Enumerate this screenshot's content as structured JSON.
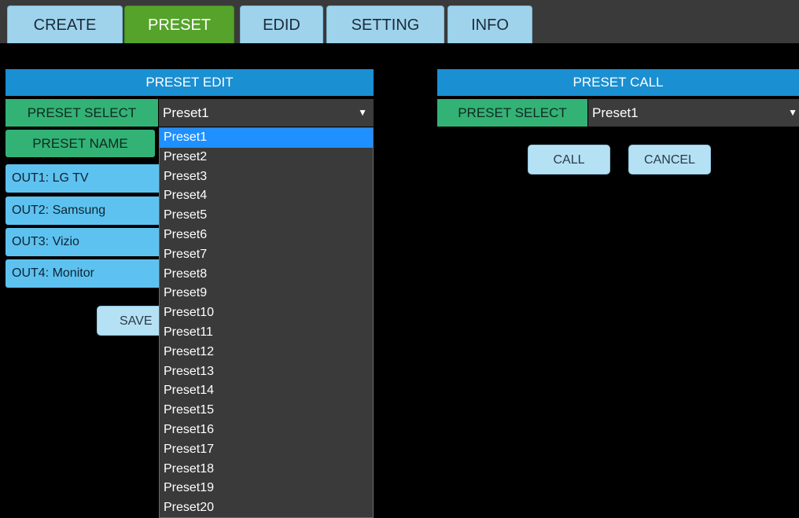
{
  "tabs": [
    {
      "label": "CREATE",
      "active": false
    },
    {
      "label": "PRESET",
      "active": true
    },
    {
      "label": "EDID",
      "active": false
    },
    {
      "label": "SETTING",
      "active": false
    },
    {
      "label": "INFO",
      "active": false
    }
  ],
  "preset_edit": {
    "title": "PRESET EDIT",
    "select_label": "PRESET SELECT",
    "selected_value": "Preset1",
    "name_label": "PRESET NAME",
    "outputs": [
      "OUT1: LG TV",
      "OUT2: Samsung",
      "OUT3: Vizio",
      "OUT4: Monitor"
    ],
    "save_label": "SAVE",
    "dropdown_options": [
      "Preset1",
      "Preset2",
      "Preset3",
      "Preset4",
      "Preset5",
      "Preset6",
      "Preset7",
      "Preset8",
      "Preset9",
      "Preset10",
      "Preset11",
      "Preset12",
      "Preset13",
      "Preset14",
      "Preset15",
      "Preset16",
      "Preset17",
      "Preset18",
      "Preset19",
      "Preset20"
    ]
  },
  "preset_call": {
    "title": "PRESET CALL",
    "select_label": "PRESET SELECT",
    "selected_value": "Preset1",
    "call_label": "CALL",
    "cancel_label": "CANCEL"
  },
  "icons": {
    "dropdown_caret": "▼"
  },
  "colors": {
    "header_blue": "#1a8fd2",
    "label_green": "#33b276",
    "active_tab_green": "#55a32a",
    "tab_light_blue": "#9fd3ec",
    "output_blue": "#5ec2f0",
    "selected_option": "#1e90ff"
  }
}
